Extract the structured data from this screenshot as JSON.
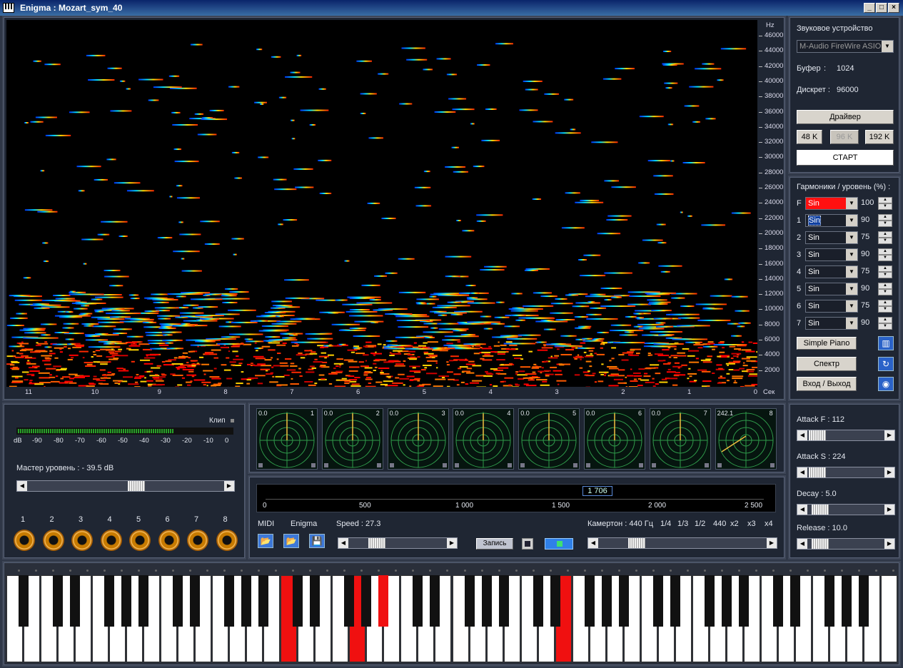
{
  "window": {
    "title": "Enigma : Mozart_sym_40",
    "buttons": [
      "_",
      "□",
      "×"
    ]
  },
  "spectrogram": {
    "y_unit": "Hz",
    "y_ticks": [
      "46000",
      "44000",
      "42000",
      "40000",
      "38000",
      "36000",
      "34000",
      "32000",
      "30000",
      "28000",
      "26000",
      "24000",
      "22000",
      "20000",
      "18000",
      "16000",
      "14000",
      "12000",
      "10000",
      "8000",
      "6000",
      "4000",
      "2000"
    ],
    "x_ticks": [
      "11",
      "10",
      "9",
      "8",
      "7",
      "6",
      "5",
      "4",
      "3",
      "2",
      "1",
      "0"
    ],
    "x_unit": "Сек"
  },
  "device": {
    "label": "Звуковое устройство",
    "selected": "M-Audio FireWire ASIO",
    "buffer_label": "Буфер",
    "buffer_value": "1024",
    "rate_label": "Дискрет :",
    "rate_value": "96000",
    "driver_button": "Драйвер",
    "rates": [
      "48 K",
      "96 K",
      "192 K"
    ],
    "start_button": "СТАРТ"
  },
  "harmonics": {
    "label": "Гармоники / уровень (%) :",
    "rows": [
      {
        "id": "F",
        "wave": "Sin",
        "level": "100"
      },
      {
        "id": "1",
        "wave": "Sin",
        "level": "90"
      },
      {
        "id": "2",
        "wave": "Sin",
        "level": "75"
      },
      {
        "id": "3",
        "wave": "Sin",
        "level": "90"
      },
      {
        "id": "4",
        "wave": "Sin",
        "level": "75"
      },
      {
        "id": "5",
        "wave": "Sin",
        "level": "90"
      },
      {
        "id": "6",
        "wave": "Sin",
        "level": "75"
      },
      {
        "id": "7",
        "wave": "Sin",
        "level": "90"
      }
    ],
    "simple_piano": "Simple Piano",
    "spectrum": "Спектр",
    "io": "Вход / Выход"
  },
  "meter": {
    "clip_label": "Клип",
    "db_label": "dB",
    "ticks": [
      "-90",
      "-80",
      "-70",
      "-60",
      "-50",
      "-40",
      "-30",
      "-20",
      "-10",
      "0"
    ],
    "master_label": "Мастер уровень : - 39.5 dB",
    "master_level": 0.55,
    "channels": [
      "1",
      "2",
      "3",
      "4",
      "5",
      "6",
      "7",
      "8"
    ]
  },
  "scopes": [
    {
      "value": "0.0",
      "num": "1"
    },
    {
      "value": "0.0",
      "num": "2"
    },
    {
      "value": "0.0",
      "num": "3"
    },
    {
      "value": "0.0",
      "num": "4"
    },
    {
      "value": "0.0",
      "num": "5"
    },
    {
      "value": "0.0",
      "num": "6"
    },
    {
      "value": "0.0",
      "num": "7"
    },
    {
      "value": "242.1",
      "num": "8"
    }
  ],
  "transport": {
    "position": "1 706",
    "ruler": [
      "0",
      "500",
      "1 000",
      "1 500",
      "2 000",
      "2 500"
    ],
    "midi": "MIDI",
    "enigma": "Enigma",
    "speed": "Speed : 27.3",
    "record": "Запись",
    "tuning": "Камертон : 440 Гц",
    "tuning_options": [
      "1/4",
      "1/3",
      "1/2",
      "440",
      "x2",
      "x3",
      "x4"
    ]
  },
  "envelope": {
    "attack_f": "Attack F : 112",
    "attack_s": "Attack S : 224",
    "decay": "Decay : 5.0",
    "release": "Release : 10.0"
  }
}
